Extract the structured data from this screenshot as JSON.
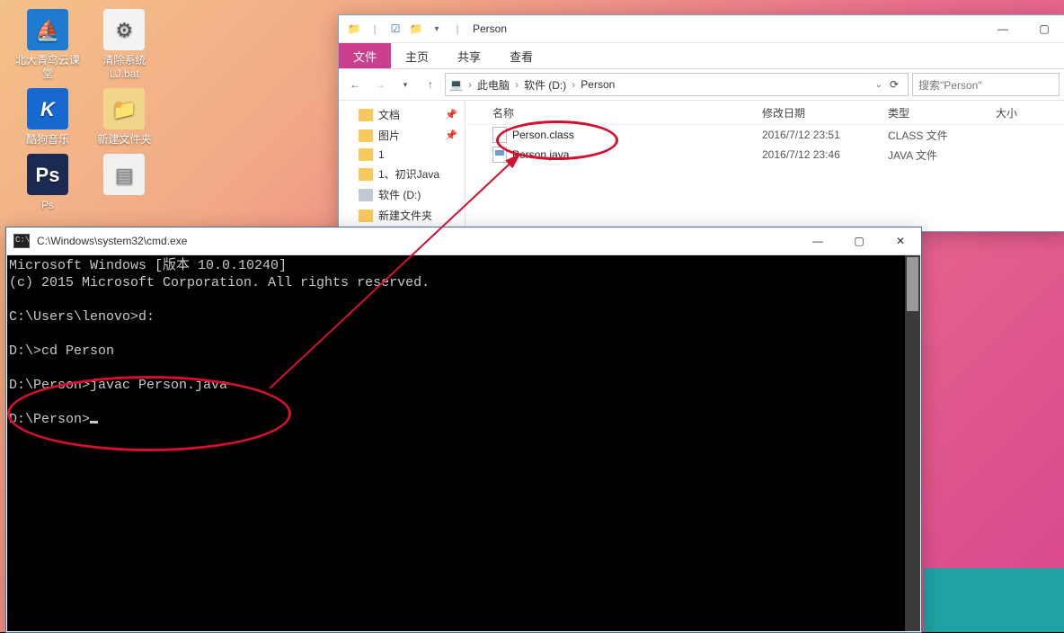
{
  "desktop": {
    "icons": [
      {
        "label": "北大青鸟云课堂",
        "tile_bg": "#1e7bd0",
        "glyph": "⛵"
      },
      {
        "label": "清除系统LJ.bat",
        "tile_bg": "#f3f3f3",
        "glyph": "⚙"
      },
      {
        "label": "酷狗音乐",
        "tile_bg": "#1769d2",
        "glyph": "K"
      },
      {
        "label": "新建文件夹",
        "tile_bg": "#f0d58a",
        "glyph": "📁"
      },
      {
        "label": "Ps",
        "tile_bg": "#1a2a52",
        "glyph": "Ps"
      },
      {
        "label": "",
        "tile_bg": "#f0f0f0",
        "glyph": "📄"
      }
    ]
  },
  "explorer": {
    "title": "Person",
    "tabs": {
      "file": "文件",
      "home": "主页",
      "share": "共享",
      "view": "查看"
    },
    "breadcrumb": [
      "此电脑",
      "软件 (D:)",
      "Person"
    ],
    "search_placeholder": "搜索\"Person\"",
    "tree": [
      {
        "label": "文档",
        "pin": true
      },
      {
        "label": "图片",
        "pin": true
      },
      {
        "label": "1"
      },
      {
        "label": "1、初识Java"
      },
      {
        "label": "软件 (D:)",
        "drive": true
      },
      {
        "label": "新建文件夹"
      }
    ],
    "columns": {
      "name": "名称",
      "date": "修改日期",
      "type": "类型",
      "size": "大小"
    },
    "rows": [
      {
        "name": "Person.class",
        "date": "2016/7/12 23:51",
        "type": "CLASS 文件",
        "kind": "class"
      },
      {
        "name": "Person.java",
        "date": "2016/7/12 23:46",
        "type": "JAVA 文件",
        "kind": "java"
      }
    ]
  },
  "cmd": {
    "title": "C:\\Windows\\system32\\cmd.exe",
    "lines": [
      "Microsoft Windows [版本 10.0.10240]",
      "(c) 2015 Microsoft Corporation. All rights reserved.",
      "",
      "C:\\Users\\lenovo>d:",
      "",
      "D:\\>cd Person",
      "",
      "D:\\Person>javac Person.java",
      "",
      "D:\\Person>"
    ]
  }
}
